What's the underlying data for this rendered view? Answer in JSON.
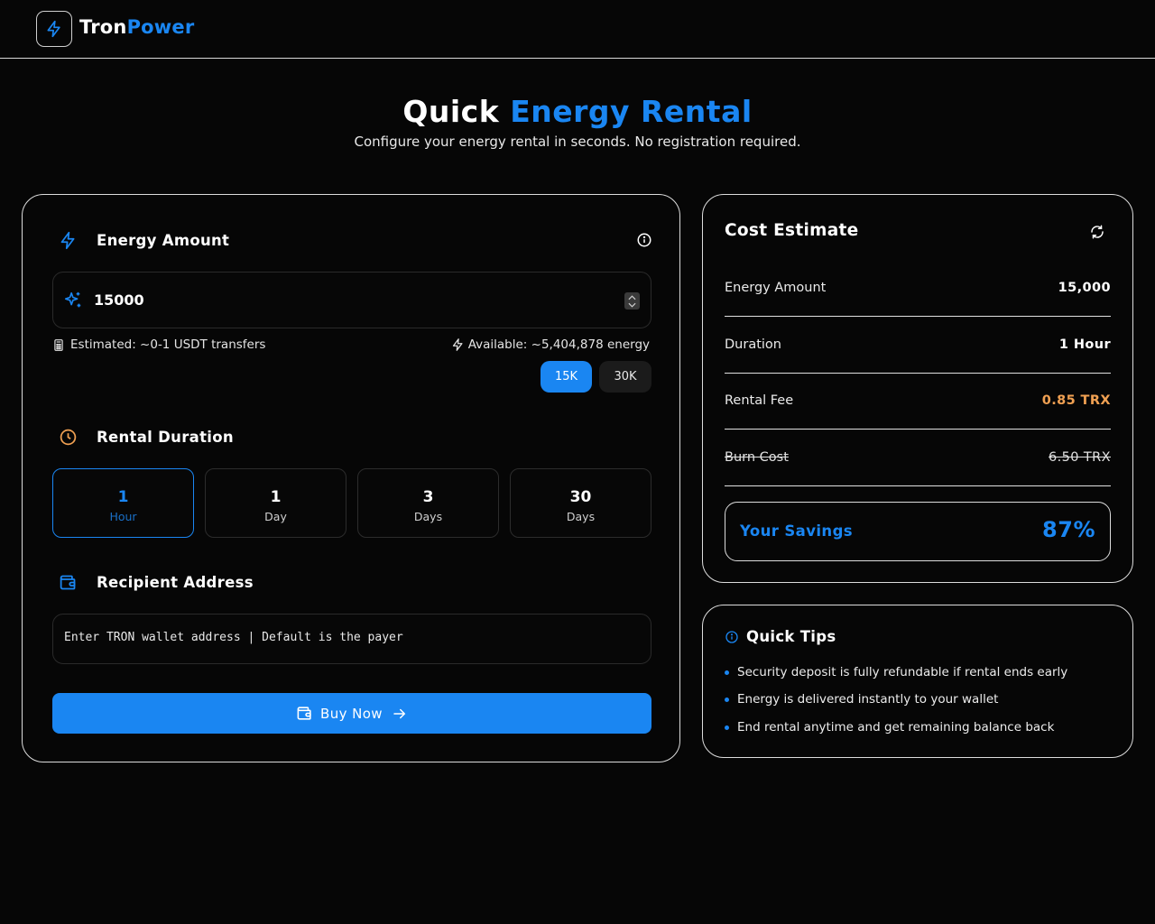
{
  "header": {
    "brand_part1": "Tron",
    "brand_part2": "Power",
    "logo_icon": "lightning-icon"
  },
  "hero": {
    "title_part1": "Quick",
    "title_part2": "Energy Rental",
    "subtitle": "Configure your energy rental in seconds. No registration required."
  },
  "energy": {
    "label": "Energy Amount",
    "value": "15000",
    "estimated": "Estimated: ~0-1 USDT transfers",
    "available": "Available: ~5,404,878 energy",
    "presets": [
      "15K",
      "30K"
    ],
    "selected_preset": "15K"
  },
  "duration": {
    "label": "Rental Duration",
    "options": [
      {
        "n": "1",
        "u": "Hour"
      },
      {
        "n": "1",
        "u": "Day"
      },
      {
        "n": "3",
        "u": "Days"
      },
      {
        "n": "30",
        "u": "Days"
      }
    ],
    "selected_index": 0
  },
  "recipient": {
    "label": "Recipient Address",
    "placeholder": "Enter TRON wallet address | Default is the payer",
    "value": ""
  },
  "buy_button": "Buy Now",
  "cost": {
    "title": "Cost Estimate",
    "rows": [
      {
        "k": "Energy Amount",
        "v": "15,000"
      },
      {
        "k": "Duration",
        "v": "1 Hour"
      },
      {
        "k": "Rental Fee",
        "v": "0.85 TRX"
      },
      {
        "k": "Burn Cost",
        "v": "6.50 TRX"
      }
    ],
    "savings_label": "Your Savings",
    "savings_value": "87%"
  },
  "tips": {
    "title": "Quick Tips",
    "items": [
      "Security deposit is fully refundable if rental ends early",
      "Energy is delivered instantly to your wallet",
      "End rental anytime and get remaining balance back"
    ]
  },
  "colors": {
    "accent": "#1a86f2",
    "fee": "#f0a052",
    "clock": "#f0a052",
    "background": "#060606"
  }
}
